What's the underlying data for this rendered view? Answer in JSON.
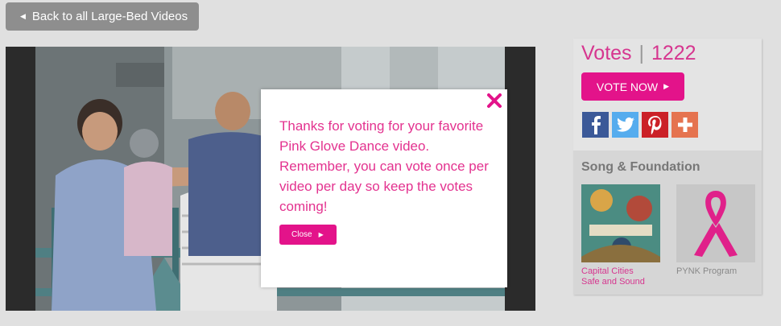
{
  "back_button": {
    "label": "Back to all Large-Bed Videos",
    "icon": "triangle-left-icon"
  },
  "modal": {
    "message": "Thanks for voting for your favorite Pink Glove Dance video. Remember, you can vote once per video per day so keep the votes coming!",
    "close_label": "Close",
    "close_icon": "close-x-icon",
    "accent_color": "#e3138a"
  },
  "sidebar": {
    "votes_label": "Votes",
    "separator": "|",
    "votes_count": "1222",
    "vote_now_label": "VOTE NOW",
    "social": [
      {
        "name": "facebook-icon",
        "glyph": "f",
        "color": "#3b5998"
      },
      {
        "name": "twitter-icon",
        "glyph": "t",
        "color": "#55acee"
      },
      {
        "name": "pinterest-icon",
        "glyph": "p",
        "color": "#cb2027"
      },
      {
        "name": "share-plus-icon",
        "glyph": "+",
        "color": "#e5734f"
      }
    ],
    "section_heading": "Song & Foundation",
    "song": {
      "line1": "Capital Cities",
      "line2": "Safe and Sound"
    },
    "foundation": {
      "label": "PYNK Program"
    }
  }
}
